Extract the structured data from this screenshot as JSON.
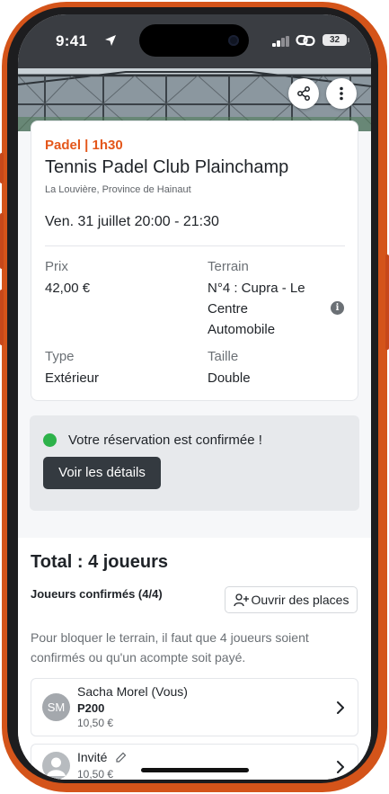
{
  "status_bar": {
    "time": "9:41",
    "battery": "32"
  },
  "colors": {
    "accent": "#e4571b",
    "success": "#2db24a",
    "dark_button": "#343a40",
    "frame": "#d4541a"
  },
  "hero": {
    "share_icon": "share-icon",
    "more_icon": "more-vertical-icon"
  },
  "booking": {
    "sport": "Padel | 1h30",
    "club_name": "Tennis Padel Club Plainchamp",
    "location": "La Louvière, Province de Hainaut",
    "slot": "Ven. 31 juillet 20:00 - 21:30",
    "price_label": "Prix",
    "price_value": "42,00 €",
    "court_label": "Terrain",
    "court_value_lines": [
      "N°4 : Cupra - Le",
      "Centre",
      "Automobile"
    ],
    "type_label": "Type",
    "type_value": "Extérieur",
    "size_label": "Taille",
    "size_value": "Double"
  },
  "confirmation": {
    "message": "Votre réservation est confirmée !",
    "details_button": "Voir les détails"
  },
  "players": {
    "total": "Total : 4 joueurs",
    "confirmed_title": "Joueurs confirmés (4/4)",
    "open_places_button": "Ouvrir des places",
    "hint": "Pour bloquer le terrain, il faut que 4 joueurs soient confirmés ou qu'un acompte soit payé.",
    "list": [
      {
        "initials": "SM",
        "name": "Sacha Morel (Vous)",
        "level": "P200",
        "price": "10,50 €"
      },
      {
        "initials": "",
        "name": "Invité",
        "level": "",
        "price": "10,50 €"
      }
    ]
  }
}
